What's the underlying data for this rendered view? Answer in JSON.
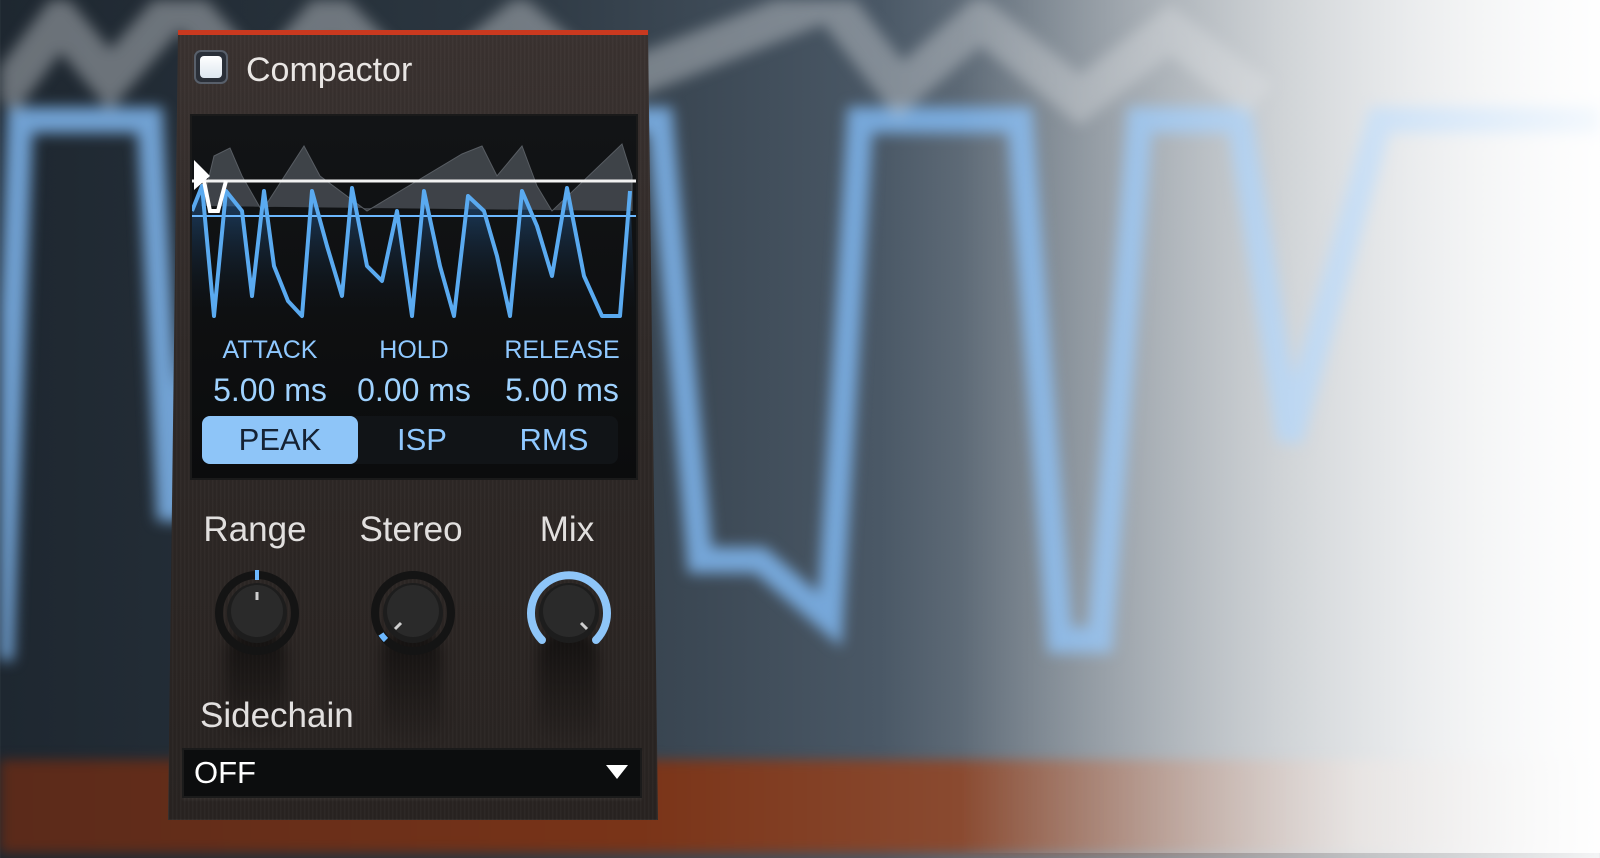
{
  "plugin": {
    "title": "Compactor",
    "bypass_enabled": true
  },
  "detector": {
    "params": [
      {
        "label": "ATTACK",
        "value": "5.00 ms"
      },
      {
        "label": "HOLD",
        "value": "0.00 ms"
      },
      {
        "label": "RELEASE",
        "value": "5.00 ms"
      }
    ],
    "modes": [
      {
        "label": "PEAK",
        "active": true
      },
      {
        "label": "ISP",
        "active": false
      },
      {
        "label": "RMS",
        "active": false
      }
    ]
  },
  "knobs": [
    {
      "label": "Range",
      "icon": "knob-icon"
    },
    {
      "label": "Stereo",
      "icon": "knob-icon"
    },
    {
      "label": "Mix",
      "icon": "knob-icon"
    }
  ],
  "sidechain": {
    "label": "Sidechain",
    "value": "OFF",
    "icon": "dropdown-arrow-icon"
  },
  "colors": {
    "accent": "#c9391f",
    "display_blue": "#8ec5f8",
    "waveform_blue": "#5aaaf0",
    "panel": "#2e2826"
  }
}
